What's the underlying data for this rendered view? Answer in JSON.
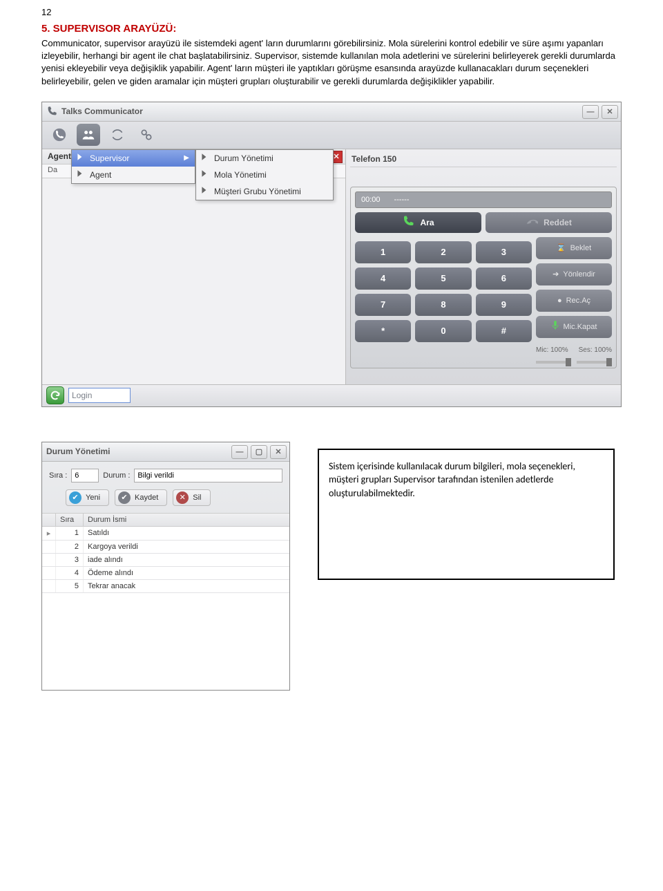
{
  "page_number": "12",
  "heading": "5. SUPERVISOR ARAYÜZÜ:",
  "body": "Communicator, supervisor arayüzü ile sistemdeki agent' ların durumlarını görebilirsiniz. Mola sürelerini kontrol edebilir ve süre aşımı yapanları izleyebilir, herhangi bir agent ile chat başlatabilirsiniz. Supervisor, sistemde kullanılan mola adetlerini ve sürelerini belirleyerek gerekli durumlarda yenisi ekleyebilir veya değişiklik yapabilir. Agent' ların müşteri ile yaptıkları görüşme esansında arayüzde kullanacakları durum seçenekleri belirleyebilir, gelen ve giden aramalar için müşteri grupları oluşturabilir ve gerekli durumlarda değişiklikler yapabilir.",
  "window": {
    "title": "Talks Communicator",
    "leftTab": "Agentl",
    "leftSub": "Da",
    "menu1": [
      "Supervisor",
      "Agent"
    ],
    "menu2": [
      "Durum Yönetimi",
      "Mola Yönetimi",
      "Müşteri Grubu Yönetimi"
    ],
    "rightTitle": "Telefon 150",
    "display_time": "00:00",
    "display_dash": "------",
    "btn_call": "Ara",
    "btn_reject": "Reddet",
    "btn_hold": "Beklet",
    "btn_transfer": "Yönlendir",
    "btn_rec": "Rec.Aç",
    "btn_mic": "Mic.Kapat",
    "keys": [
      "1",
      "2",
      "3",
      "4",
      "5",
      "6",
      "7",
      "8",
      "9",
      "*",
      "0",
      "#"
    ],
    "vol_mic": "Mic: 100%",
    "vol_ses": "Ses: 100%",
    "login": "Login"
  },
  "durum": {
    "title": "Durum Yönetimi",
    "lbl_sira": "Sıra :",
    "val_sira": "6",
    "lbl_durum": "Durum :",
    "val_durum": "Bilgi verildi",
    "btn_new": "Yeni",
    "btn_save": "Kaydet",
    "btn_del": "Sil",
    "col_sira": "Sıra",
    "col_isim": "Durum İsmi",
    "rows": [
      {
        "n": "1",
        "t": "Satıldı"
      },
      {
        "n": "2",
        "t": "Kargoya verildi"
      },
      {
        "n": "3",
        "t": "iade alındı"
      },
      {
        "n": "4",
        "t": "Ödeme alındı"
      },
      {
        "n": "5",
        "t": "Tekrar anacak"
      }
    ]
  },
  "note": "Sistem içerisinde kullanılacak durum bilgileri, mola seçenekleri, müşteri grupları Supervisor tarafından istenilen adetlerde oluşturulabilmektedir."
}
